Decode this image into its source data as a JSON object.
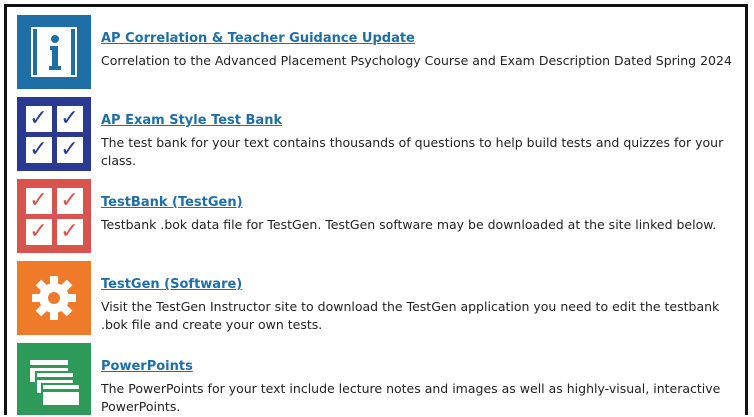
{
  "resources": [
    {
      "title": "AP Correlation & Teacher Guidance Update",
      "description": "Correlation to the Advanced Placement Psychology Course and Exam Description Dated Spring 2024",
      "icon": "info-icon",
      "color": "#1f6fa6"
    },
    {
      "title": "AP Exam Style Test Bank",
      "description": "The test bank for your text contains thousands of questions to help build tests and quizzes for your class.",
      "icon": "checkbox-grid-icon",
      "color": "#2a3a8f"
    },
    {
      "title": "TestBank (TestGen)",
      "description": "Testbank .bok data file for TestGen. TestGen software may be downloaded at the site linked below.",
      "icon": "checkbox-grid-icon",
      "color": "#d9534f"
    },
    {
      "title": "TestGen (Software)",
      "description": "Visit the TestGen Instructor site to download the TestGen application you need to edit the testbank .bok file and create your own tests.",
      "icon": "gear-icon",
      "color": "#ef7a2a"
    },
    {
      "title": "PowerPoints",
      "description": "The PowerPoints for your text include lecture notes and images as well as highly-visual, interactive PowerPoints.",
      "icon": "slides-icon",
      "color": "#2e9a5a"
    }
  ]
}
